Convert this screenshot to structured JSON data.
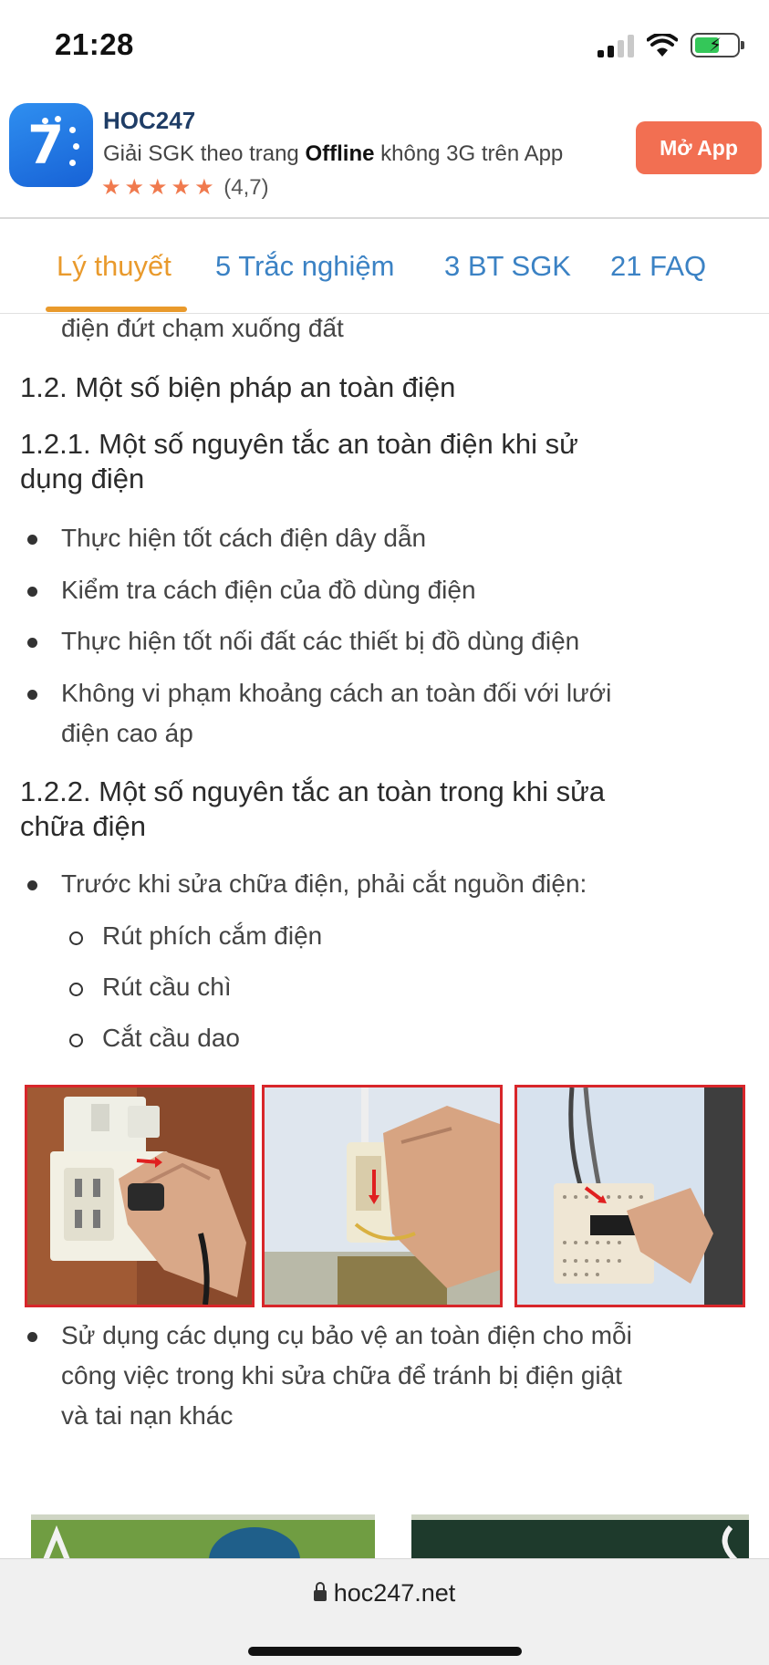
{
  "status_bar": {
    "time": "21:28"
  },
  "app_banner": {
    "name": "HOC247",
    "desc_prefix": "Giải SGK theo trang ",
    "desc_bold": "Offline",
    "desc_suffix": " không 3G trên App",
    "stars": "★★★★★",
    "rating": "(4,7)",
    "open_button": "Mở App",
    "logo_text": "7"
  },
  "tabs": [
    {
      "label": "Lý thuyết",
      "active": true
    },
    {
      "label": "5 Trắc nghiệm",
      "active": false
    },
    {
      "label": "3 BT SGK",
      "active": false
    },
    {
      "label": "21 FAQ",
      "active": false
    }
  ],
  "content": {
    "continued_text": "điện đứt chạm xuống đất",
    "heading_1_2": "1.2. Một số biện pháp an toàn điện",
    "heading_1_2_1_line1": "1.2.1. Một số nguyên tắc an toàn điện khi sử",
    "heading_1_2_1_line2": "dụng điện",
    "bullets_1": [
      "Thực hiện tốt cách điện dây dẫn",
      "Kiểm tra cách điện của đồ dùng điện",
      "Thực hiện tốt nối đất các thiết bị đồ dùng điện"
    ],
    "bullet_1_4_line1": "Không vi phạm khoảng cách an toàn đối với lưới",
    "bullet_1_4_line2": "điện cao áp",
    "heading_1_2_2_line1": "1.2.2. Một số nguyên tắc an toàn trong khi sửa",
    "heading_1_2_2_line2": "chữa điện",
    "bullet_2_1": "Trước khi sửa chữa điện, phải cắt nguồn điện:",
    "sub_bullets": [
      "Rút phích cắm điện",
      "Rút cầu chì",
      "Cắt cầu dao"
    ],
    "bullet_2_2_line1": "Sử dụng các dụng cụ bảo vệ an toàn điện cho mỗi",
    "bullet_2_2_line2": "công việc trong khi sửa chữa để tránh bị điện giật",
    "bullet_2_2_line3": "và tai nạn khác"
  },
  "url_bar": {
    "url": "hoc247.net"
  },
  "colors": {
    "accent_orange": "#e99a2c",
    "tab_blue": "#3b82c4",
    "open_app_button": "#f26f52",
    "photo_border": "#d8262a"
  }
}
